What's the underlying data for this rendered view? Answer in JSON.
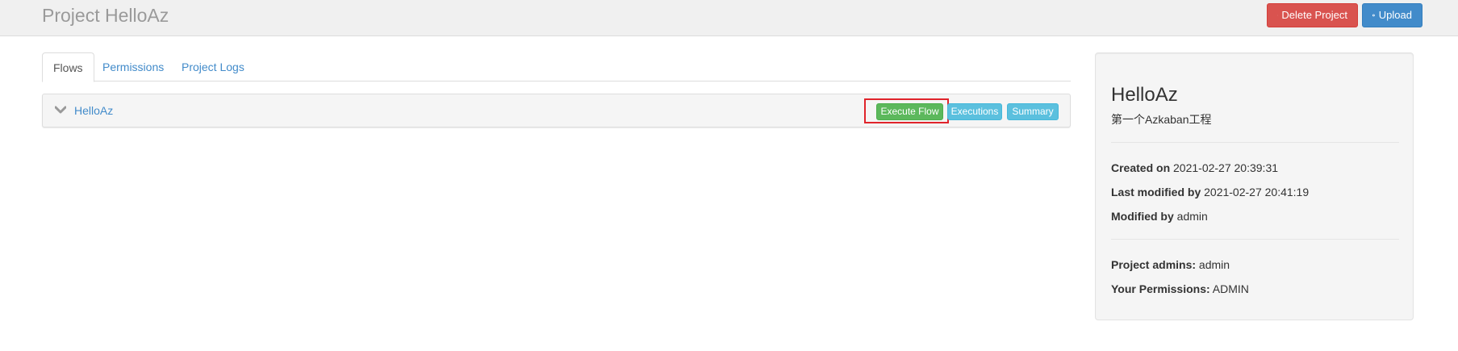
{
  "header": {
    "title": "Project HelloAz",
    "delete_label": "Delete Project",
    "upload_label": "Upload"
  },
  "tabs": [
    {
      "label": "Flows",
      "active": true
    },
    {
      "label": "Permissions",
      "active": false
    },
    {
      "label": "Project Logs",
      "active": false
    }
  ],
  "flow": {
    "name": "HelloAz",
    "execute_label": "Execute Flow",
    "executions_label": "Executions",
    "summary_label": "Summary"
  },
  "sidebar": {
    "title": "HelloAz",
    "description": "第一个Azkaban工程",
    "created_on_label": "Created on",
    "created_on_value": "2021-02-27 20:39:31",
    "last_modified_label": "Last modified by",
    "last_modified_value": "2021-02-27 20:41:19",
    "modified_by_label": "Modified by",
    "modified_by_value": "admin",
    "project_admins_label": "Project admins:",
    "project_admins_value": "admin",
    "permissions_label": "Your Permissions:",
    "permissions_value": "ADMIN"
  },
  "icons": {
    "delete": "trash-icon",
    "upload": "circle-arrow-up-icon",
    "expand": "chevron-down-icon"
  },
  "colors": {
    "danger": "#d9534f",
    "primary": "#428bca",
    "success": "#5cb85c",
    "info": "#5bc0de",
    "highlight": "#e0242b"
  }
}
